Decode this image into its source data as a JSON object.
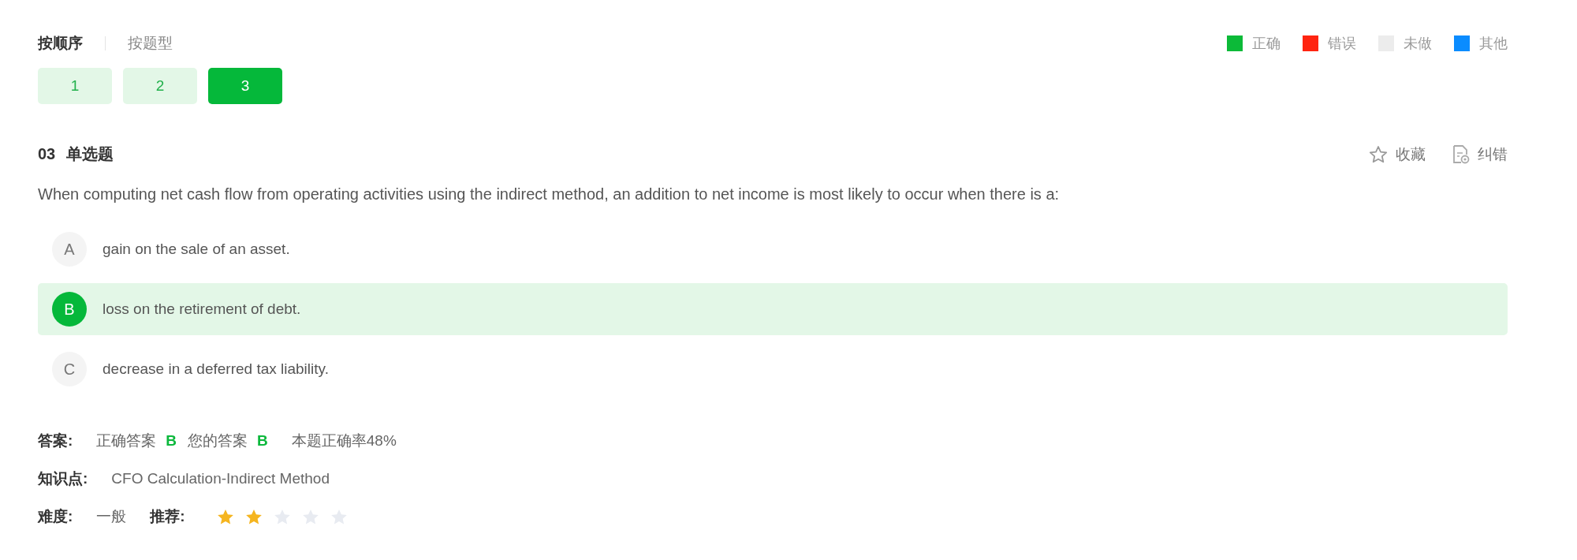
{
  "sort_tabs": [
    {
      "label": "按顺序",
      "selected": true
    },
    {
      "label": "按题型",
      "selected": false
    }
  ],
  "legend": [
    {
      "label": "正确",
      "color": "#0cba38"
    },
    {
      "label": "错误",
      "color": "#ff2410"
    },
    {
      "label": "未做",
      "color": "#ececec"
    },
    {
      "label": "其他",
      "color": "#0a8cff"
    }
  ],
  "question_numbers": [
    {
      "label": "1",
      "selected": false
    },
    {
      "label": "2",
      "selected": false
    },
    {
      "label": "3",
      "selected": true
    }
  ],
  "question": {
    "number": "03",
    "type": "单选题",
    "text": "When computing net cash flow from operating activities using the indirect method, an addition to net income is most likely to occur when there is a:"
  },
  "actions": [
    {
      "kind": "favorite",
      "label": "收藏"
    },
    {
      "kind": "report",
      "label": "纠错"
    }
  ],
  "options": [
    {
      "letter": "A",
      "text": "gain on the sale of an asset.",
      "selected": false
    },
    {
      "letter": "B",
      "text": "loss on the retirement of debt.",
      "selected": true
    },
    {
      "letter": "C",
      "text": "decrease in a deferred tax liability.",
      "selected": false
    }
  ],
  "answer": {
    "label": "答案:",
    "correct_label": "正确答案",
    "correct": "B",
    "yours_label": "您的答案",
    "yours": "B",
    "rate": "本题正确率48%"
  },
  "knowledge": {
    "label": "知识点:",
    "value": "CFO Calculation-Indirect Method"
  },
  "difficulty": {
    "label": "难度:",
    "value": "一般"
  },
  "recommend": {
    "label": "推荐:",
    "stars": 2
  }
}
